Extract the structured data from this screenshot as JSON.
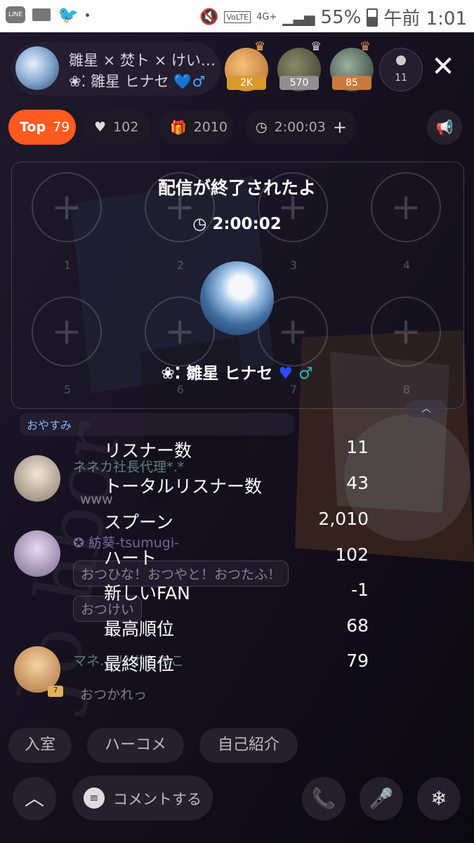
{
  "status_bar": {
    "battery": "55%",
    "time": "午前 1:01",
    "network": "4G+",
    "volte": "VoLTE"
  },
  "header": {
    "host_title": "雛星 × 焚ト × けい…",
    "host_name": "❀⁚ 雛星 ヒナセ",
    "host_name_suffix": "💙♂",
    "ranks": [
      {
        "badge": "2K",
        "color": "#d89a2c"
      },
      {
        "badge": "570",
        "color": "#9a9a9a"
      },
      {
        "badge": "85",
        "color": "#c9793c"
      }
    ],
    "listener_count": "11",
    "close_label": "✕"
  },
  "stats_chips": {
    "top_label": "Top",
    "top_value": "79",
    "hearts": "102",
    "spoons": "2010",
    "duration": "2:00:03"
  },
  "end_panel": {
    "title": "配信が終了されたよ",
    "duration": "2:00:02",
    "host_name": "❀⁚ 雛星 ヒナセ",
    "slot_numbers": [
      "1",
      "2",
      "3",
      "4",
      "5",
      "6",
      "7",
      "8"
    ]
  },
  "stats": [
    {
      "label": "リスナー数",
      "value": "11"
    },
    {
      "label": "トータルリスナー数",
      "value": "43"
    },
    {
      "label": "スプーン",
      "value": "2,010"
    },
    {
      "label": "ハート",
      "value": "102"
    },
    {
      "label": "新しいFAN",
      "value": "-1"
    },
    {
      "label": "最高順位",
      "value": "68"
    },
    {
      "label": "最終順位",
      "value": "79"
    }
  ],
  "chat": {
    "pinned": "おやすみ",
    "messages": [
      {
        "user": "ネネカ社長代理*.*",
        "text": "www"
      },
      {
        "user": "紡葵-tsumugi-",
        "text": "おつひな！おつやと！おつたふ！",
        "text2": "おつけい"
      },
      {
        "user": "マネ… リボもちこ",
        "text": "おつかれっ",
        "badge": "7"
      }
    ]
  },
  "quick_replies": [
    "入室",
    "ハーコメ",
    "自己紹介"
  ],
  "comment_placeholder": "コメントする",
  "colors": {
    "top_chip": "#ff5a1f",
    "heart_blue": "#2a4bff",
    "male_teal": "#1fc2a6"
  }
}
